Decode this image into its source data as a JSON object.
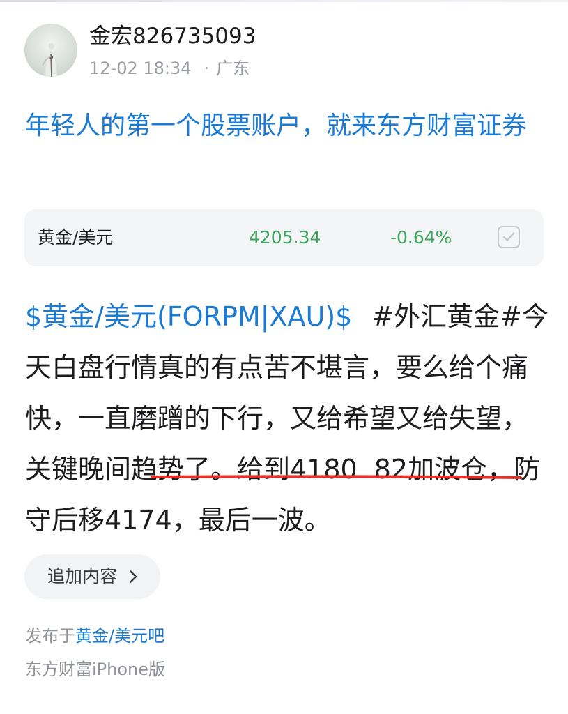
{
  "author": {
    "name": "金宏826735093",
    "time": "12-02 18:34",
    "separator": "·",
    "location": "广东"
  },
  "ad": {
    "title": "年轻人的第一个股票账户，就来东方财富证券"
  },
  "quote": {
    "name": "黄金/美元",
    "price": "4205.34",
    "change": "-0.64%",
    "trend_color": "#3aa55a"
  },
  "post": {
    "stock_tag": "$黄金/美元(FORPM|XAU)$",
    "text_a": "#外汇黄金#今天白盘行情真的有点苦不堪言，要么给个痛快，一直磨蹭的下行，又给希望又给失望，关键晚间趋势了。给到4180",
    "text_b": "82加波仓，防守后移4174，最后一波。"
  },
  "annotation": {
    "color": "#e8302a"
  },
  "actions": {
    "add_content_label": "追加内容"
  },
  "footer": {
    "posted_in_prefix": "发布于",
    "forum_name": "黄金/美元吧",
    "device": "东方财富iPhone版"
  },
  "colors": {
    "link_blue": "#1a7ad4",
    "text_dark": "#1c1c1e",
    "text_gray": "#8f9399",
    "card_bg": "#f4f5f7"
  },
  "icons": {
    "checkbox": "checkbox-icon",
    "chevron": "chevron-right-icon"
  }
}
